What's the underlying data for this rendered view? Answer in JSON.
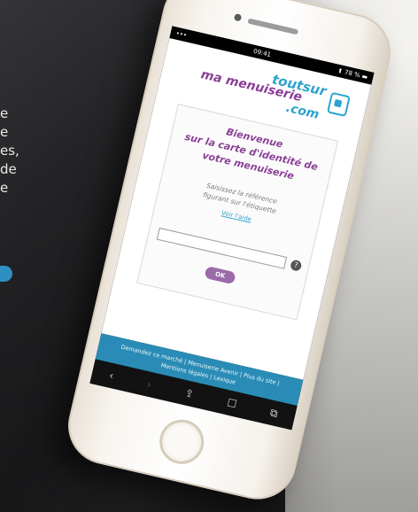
{
  "background": {
    "text_fragments": [
      "e",
      "e",
      "es,",
      "",
      "de",
      "e"
    ],
    "accent_color": "#2f8fc0"
  },
  "phone": {
    "status": {
      "time": "09:41",
      "right": "⬆ 78 % ▬"
    },
    "brand": {
      "top": "toutsur",
      "mid": "ma menuiserie",
      "bot": ".com"
    },
    "welcome": [
      "Bienvenue",
      "sur la carte d'identité de",
      "votre menuiserie"
    ],
    "instruction": [
      "Saisissez la référence",
      "figurant sur l'étiquette"
    ],
    "link": "Voir l'aide",
    "input": {
      "value": "",
      "placeholder": ""
    },
    "help_label": "?",
    "ok_label": "OK",
    "footer_lines": [
      "Demandez ce marché | Menuiserie Avenir | Plus du site |",
      "Mentions légales | Lexique"
    ],
    "toolbar_icons": [
      "back-icon",
      "forward-icon",
      "share-icon",
      "bookmarks-icon",
      "tabs-icon"
    ],
    "colors": {
      "brand_blue": "#2ea3cf",
      "brand_purple": "#8a3f96",
      "footer_blue": "#2a8cb6"
    }
  }
}
